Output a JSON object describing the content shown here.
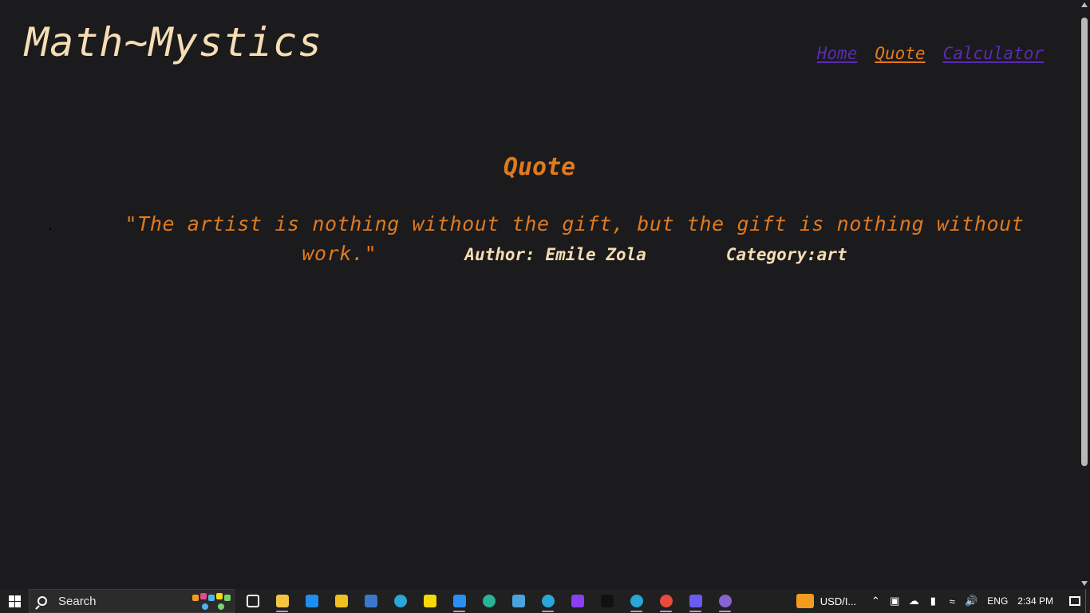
{
  "site": {
    "logo": "Math~Mystics"
  },
  "nav": {
    "items": [
      {
        "label": "Home",
        "state": "visited"
      },
      {
        "label": "Quote",
        "state": "active"
      },
      {
        "label": "Calculator",
        "state": "visited"
      }
    ]
  },
  "main": {
    "section_title": "Quote",
    "quote": {
      "text": "\"The artist is nothing without the gift, but the gift is nothing without work.\"",
      "author": "Author: Emile Zola",
      "category": "Category:art"
    }
  },
  "taskbar": {
    "search_placeholder": "Search",
    "apps": [
      {
        "name": "task-view-icon",
        "color": "#ffffff"
      },
      {
        "name": "file-explorer-icon",
        "color": "#f4c542"
      },
      {
        "name": "mail-icon",
        "color": "#1f8ef1"
      },
      {
        "name": "git-icon",
        "color": "#f0c020"
      },
      {
        "name": "powershell-icon",
        "color": "#3a78c9"
      },
      {
        "name": "edge-icon",
        "color": "#2aa7d8"
      },
      {
        "name": "sticky-notes-icon",
        "color": "#f5d90a"
      },
      {
        "name": "vscode-icon",
        "color": "#2a8ef5"
      },
      {
        "name": "app-green-icon",
        "color": "#2bb39a"
      },
      {
        "name": "keyboard-icon",
        "color": "#4aa3df"
      },
      {
        "name": "edge-dev-icon",
        "color": "#2aa7d8"
      },
      {
        "name": "app-purple-icon",
        "color": "#8a3ff0"
      },
      {
        "name": "tiktok-icon",
        "color": "#111111"
      },
      {
        "name": "edge-beta-icon",
        "color": "#2aa7d8"
      },
      {
        "name": "chrome-icon",
        "color": "#e94b3c"
      },
      {
        "name": "app-multicolor-icon",
        "color": "#6a5cf0"
      },
      {
        "name": "github-desktop-icon",
        "color": "#8a63d2"
      }
    ],
    "widget_label": "USD/I...",
    "language": "ENG",
    "time": "2:34 PM"
  }
}
